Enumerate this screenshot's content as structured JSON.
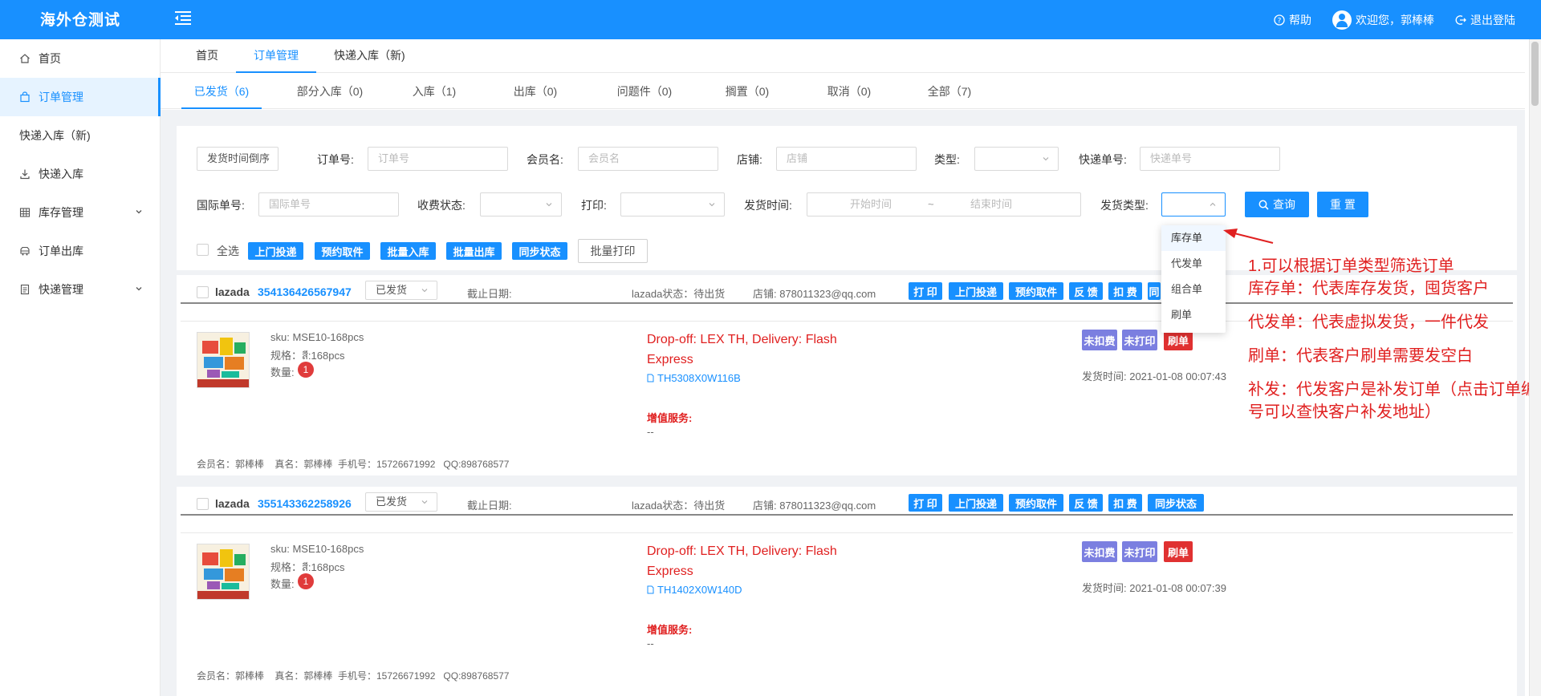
{
  "app": {
    "title": "海外仓测试"
  },
  "header": {
    "help": "帮助",
    "welcome": "欢迎您，郭棒棒",
    "logout": "退出登陆"
  },
  "sidebar": {
    "items": [
      {
        "label": "首页",
        "icon": "home-icon"
      },
      {
        "label": "订单管理",
        "icon": "bag-icon",
        "active": true
      },
      {
        "label": "快递入库（新)"
      },
      {
        "label": "快递入库",
        "icon": "download-icon"
      },
      {
        "label": "库存管理",
        "icon": "grid-icon",
        "expandable": true
      },
      {
        "label": "订单出库",
        "icon": "truck-icon"
      },
      {
        "label": "快递管理",
        "icon": "doc-icon",
        "expandable": true
      }
    ]
  },
  "tabs": [
    {
      "label": "首页"
    },
    {
      "label": "订单管理",
      "active": true
    },
    {
      "label": "快递入库（新)"
    }
  ],
  "status_tabs": [
    {
      "label": "已发货（6)",
      "active": true
    },
    {
      "label": "部分入库（0)"
    },
    {
      "label": "入库（1)"
    },
    {
      "label": "出库（0)"
    },
    {
      "label": "问题件（0)"
    },
    {
      "label": "搁置（0)"
    },
    {
      "label": "取消（0)"
    },
    {
      "label": "全部（7)"
    }
  ],
  "filters": {
    "sort_select": "发货时间倒序",
    "order_no_label": "订单号:",
    "order_no_placeholder": "订单号",
    "member_label": "会员名:",
    "member_placeholder": "会员名",
    "store_label": "店铺:",
    "store_placeholder": "店铺",
    "type_label": "类型:",
    "express_label": "快递单号:",
    "express_placeholder": "快递单号",
    "intl_label": "国际单号:",
    "intl_placeholder": "国际单号",
    "fee_label": "收费状态:",
    "print_label": "打印:",
    "ship_time_label": "发货时间:",
    "start_placeholder": "开始时间",
    "range_sep": "~",
    "end_placeholder": "结束时间",
    "ship_type_label": "发货类型:",
    "query": "查询",
    "reset": "重 置"
  },
  "toolbar": {
    "select_all": "全选",
    "buttons": [
      "上门投递",
      "预约取件",
      "批量入库",
      "批量出库",
      "同步状态"
    ],
    "batch_print": "批量打印"
  },
  "ship_type_dropdown": [
    "库存单",
    "代发单",
    "组合单",
    "刷单"
  ],
  "annotation": [
    "1.可以根据订单类型筛选订单",
    "库存单：代表库存发货，囤货客户",
    "",
    "代发单：代表虚拟发货，一件代发",
    "",
    "刷单：代表客户刷单需要发空白",
    "",
    "补发：代发客户是补发订单（点击订单编号可以查快客户补发地址）"
  ],
  "orders": [
    {
      "platform": "lazada",
      "order_no": "354136426567947",
      "status": "已发货",
      "deadline_label": "截止日期:",
      "platform_status": "lazada状态：待出货",
      "store": "店铺:  878011323@qq.com",
      "actions": [
        "打 印",
        "上门投递",
        "预约取件",
        "反 馈",
        "扣 费",
        "同"
      ],
      "sku": "sku: MSE10-168pcs",
      "spec": "规格：สี:168pcs",
      "qty_label": "数量:",
      "qty": "1",
      "logistics": "Drop-off: LEX TH, Delivery: Flash Express",
      "tracking": "TH5308X0W116B",
      "vas_label": "增值服务:",
      "vas_value": "--",
      "tags": [
        "未扣费",
        "未打印",
        "刷单"
      ],
      "ship_time": "发货时间:  2021-01-08 00:07:43",
      "member": "会员名：郭棒棒    真名：郭棒棒  手机号：15726671992   QQ:898768577"
    },
    {
      "platform": "lazada",
      "order_no": "355143362258926",
      "status": "已发货",
      "deadline_label": "截止日期:",
      "platform_status": "lazada状态：待出货",
      "store": "店铺:  878011323@qq.com",
      "actions": [
        "打 印",
        "上门投递",
        "预约取件",
        "反 馈",
        "扣 费",
        "同步状态"
      ],
      "sku": "sku: MSE10-168pcs",
      "spec": "规格：สี:168pcs",
      "qty_label": "数量:",
      "qty": "1",
      "logistics": "Drop-off: LEX TH, Delivery: Flash Express",
      "tracking": "TH1402X0W140D",
      "vas_label": "增值服务:",
      "vas_value": "--",
      "tags": [
        "未扣费",
        "未打印",
        "刷单"
      ],
      "ship_time": "发货时间:  2021-01-08 00:07:39",
      "member": "会员名：郭棒棒    真名：郭棒棒  手机号：15726671992   QQ:898768577"
    }
  ],
  "colors": {
    "primary": "#1890ff",
    "tag_purple": "#7b7fe0",
    "tag_red": "#e03131",
    "annotation_red": "#e02020"
  }
}
